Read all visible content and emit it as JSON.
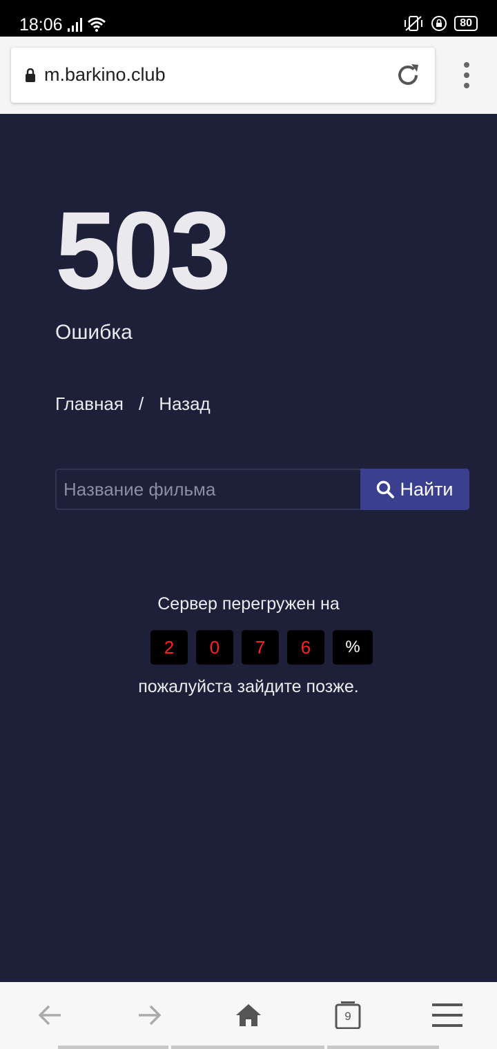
{
  "status": {
    "time": "18:06",
    "battery": "80"
  },
  "browser": {
    "url": "m.barkino.club",
    "tab_count": "9"
  },
  "error": {
    "code": "503",
    "text": "Ошибка"
  },
  "breadcrumb": {
    "home": "Главная",
    "separator": "/",
    "back": "Назад"
  },
  "search": {
    "placeholder": "Название фильма",
    "button_label": "Найти"
  },
  "load": {
    "prefix": "Сервер перегружен на",
    "digits": [
      "2",
      "0",
      "7",
      "6"
    ],
    "percent_sign": "%",
    "suffix": "пожалуйста зайдите позже."
  },
  "colors": {
    "background": "#1d2038",
    "accent_button": "#3b3f8f",
    "digit_red": "#ff2020"
  },
  "icons": {
    "lock": "lock-icon",
    "reload": "reload-icon",
    "menu": "more-vert-icon",
    "search": "search-icon",
    "back": "arrow-left-icon",
    "forward": "arrow-right-icon",
    "home": "home-icon",
    "tabs": "tabs-icon",
    "hamburger": "hamburger-menu-icon"
  }
}
